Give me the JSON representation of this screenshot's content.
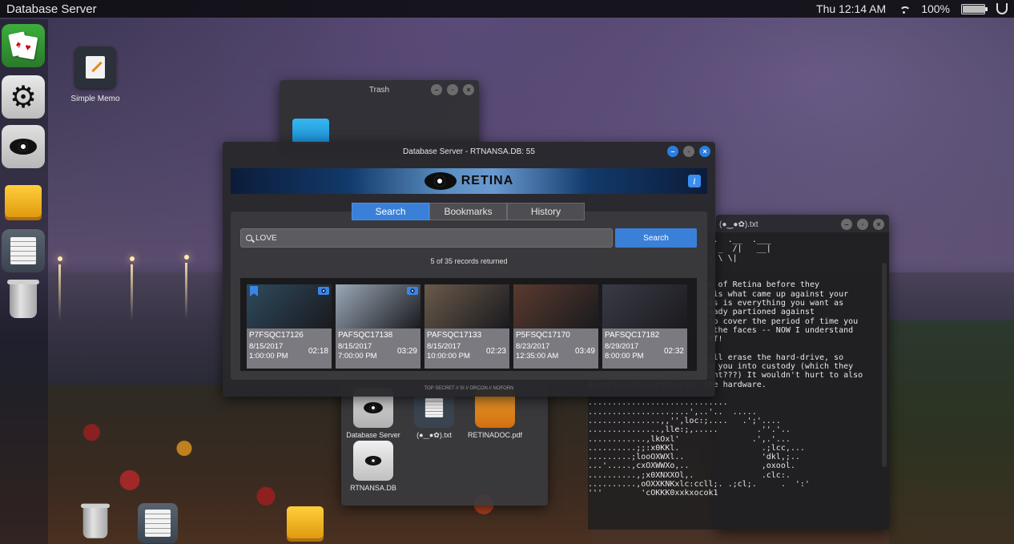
{
  "topbar": {
    "app_title": "Database Server",
    "clock": "Thu 12:14 AM",
    "battery_percent": "100%",
    "battery_level": 1.0
  },
  "dock": [
    {
      "icon": "cards-icon"
    },
    {
      "icon": "gear-icon"
    },
    {
      "icon": "eye-icon"
    },
    {
      "icon": "drive-icon"
    },
    {
      "icon": "notes-icon"
    },
    {
      "icon": "trash-icon"
    }
  ],
  "desktop": {
    "memo_label": "Simple Memo"
  },
  "trash_window": {
    "title": "Trash"
  },
  "files_window": {
    "items": [
      {
        "label": "Database Server",
        "icon": "eye-icon"
      },
      {
        "label": "(●‿●✿).txt",
        "icon": "text-file-icon"
      },
      {
        "label": "RETINADOC.pdf",
        "icon": "pdf-icon"
      },
      {
        "label": "RTNANSA.DB",
        "icon": "database-icon"
      }
    ]
  },
  "text_window": {
    "title": "(●‿●✿).txt",
    "lines": [
      "  _____________.   .   .  .  .__  .___",
      "  /   |    <     / /\\ \\ |  _  /|   __|",
      "  \\ \\  | . \\   / ____ \\| | \\ \\|",
      "   \\_\\ |_|\\_\\/_/    \\_\\_|",
      "",
      "                      dump of Retina before they",
      "                      his is what came up against your",
      "                       this is everything you want as",
      "                      already partioned against",
      "                      ms to cover the period of time you",
      "                       of the faces -- NOW I understand",
      "                      stuff!",
      "",
      "                      t will erase the hard-drive, so",
      "                      take you into custody (which they",
      "will -- you know this, right???) It wouldn't hurt to also",
      "burn/dissolve/pulverize the hardware.",
      "",
      ".............................",
      ".....................',..'..  .....",
      "...............,,'',loc:;....   .';'....",
      "...............,lle:;,.....        .''.'..",
      "............,lkOxl'               .',.'...",
      "..........;;:x0KKl.                 .;lcc,...",
      ".........;looOXWXl..                'dkl,;..",
      "...'.....,cxOXWWXo,..               ,oxool.",
      "..........,;x0XNXXOl,.              .clc:.",
      "..........,oOXXKNKxlc:ccll;. .;cl;.     .  ':'",
      "'''        'cOKKK0xxkxocok1"
    ]
  },
  "retina": {
    "title": "Database Server - RTNANSA.DB: 55",
    "logo_text": "RETINA",
    "info_label": "i",
    "tabs": [
      {
        "label": "Search",
        "active": true
      },
      {
        "label": "Bookmarks",
        "active": false
      },
      {
        "label": "History",
        "active": false
      }
    ],
    "search_query": "LOVE",
    "search_button": "Search",
    "results_count": "5 of 35 records returned",
    "classification": "TOP SECRET // SI // ORCON // NOFORN",
    "results": [
      {
        "id": "P7FSQC17126",
        "date": "8/15/2017",
        "time": "1:00:00 PM",
        "duration": "02:18",
        "bookmarked": true,
        "viewed": true,
        "thumb_color": "#2e4a5e"
      },
      {
        "id": "PAFSQC17138",
        "date": "8/15/2017",
        "time": "7:00:00 PM",
        "duration": "03:29",
        "bookmarked": false,
        "viewed": true,
        "thumb_color": "#9aa8b8"
      },
      {
        "id": "PAFSQC17133",
        "date": "8/15/2017",
        "time": "10:00:00 PM",
        "duration": "02:23",
        "bookmarked": false,
        "viewed": false,
        "thumb_color": "#6a5a4a"
      },
      {
        "id": "P5FSQC17170",
        "date": "8/23/2017",
        "time": "12:35:00 AM",
        "duration": "03:49",
        "bookmarked": false,
        "viewed": false,
        "thumb_color": "#5a3a2e"
      },
      {
        "id": "PAFSQC17182",
        "date": "8/29/2017",
        "time": "8:00:00 PM",
        "duration": "02:32",
        "bookmarked": false,
        "viewed": false,
        "thumb_color": "#3a3a46"
      }
    ]
  }
}
